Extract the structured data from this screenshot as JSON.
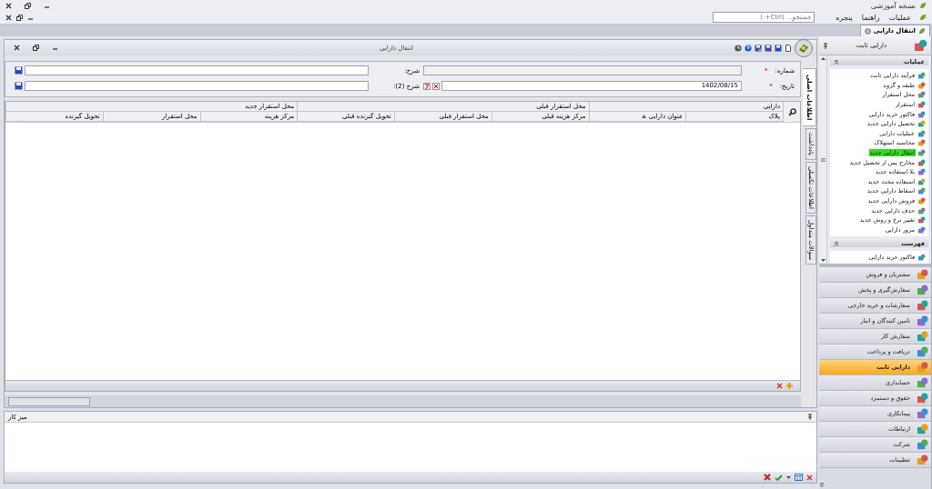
{
  "app": {
    "title": "نسخه آموزشی"
  },
  "menu": [
    {
      "label": "عملیات"
    },
    {
      "label": "راهنما"
    },
    {
      "label": "پنجره"
    }
  ],
  "search": {
    "placeholder": "جستجو... (Ctrl+-)"
  },
  "doc_tabs": [
    {
      "label": "انتقال دارایی",
      "selected": true
    }
  ],
  "window": {
    "title": "انتقال دارایی"
  },
  "side_tabs": [
    {
      "label": "اطلاعات اصلی",
      "selected": true
    },
    {
      "label": "یادداشت",
      "selected": false
    },
    {
      "label": "اطلاعات تکمیلی",
      "selected": false
    },
    {
      "label": "سوالات متداول",
      "selected": false
    }
  ],
  "form": {
    "fields": [
      {
        "label": "شماره:",
        "mark": "*",
        "disabled": true
      },
      {
        "label": "شرح:",
        "disabled": false
      },
      {
        "label": "تاریخ:",
        "mark": "*",
        "value": "1402/08/15",
        "disabled": false
      },
      {
        "label": "شرح (2):",
        "disabled": false
      }
    ]
  },
  "grid": {
    "groups": [
      {
        "label": "دارایی",
        "columns": [
          {
            "label": "پلاک",
            "sorted": false
          },
          {
            "label": "عنوان دارایی",
            "sorted": true
          }
        ]
      },
      {
        "label": "محل استقرار قبلی",
        "columns": [
          {
            "label": "مرکز هزینه قبلی",
            "sorted": false
          },
          {
            "label": "محل استقرار قبلی",
            "sorted": false
          },
          {
            "label": "تحویل گیرنده قبلی",
            "sorted": false
          }
        ]
      },
      {
        "label": "محل استقرار جدید",
        "columns": [
          {
            "label": "مرکز هزینه",
            "sorted": false
          },
          {
            "label": "محل استقرار",
            "sorted": false
          },
          {
            "label": "تحویل گیرنده",
            "sorted": false
          }
        ]
      }
    ]
  },
  "workspace": {
    "title": "میز کار"
  },
  "sidebar": {
    "title": "دارایی ثابت",
    "sections": [
      {
        "title": "عملیات",
        "expanded": true,
        "items": [
          {
            "label": "فرآیند دارایی ثابت",
            "selected": false
          },
          {
            "label": "طبقه و گروه",
            "selected": false
          },
          {
            "label": "محل استقرار",
            "selected": false
          },
          {
            "label": "استقرار",
            "selected": false
          },
          {
            "label": "فاکتور خرید دارایی",
            "selected": false
          },
          {
            "label": "تحصیل دارایی جدید",
            "selected": false
          },
          {
            "label": "عملیات دارایی",
            "selected": false
          },
          {
            "label": "محاسبه استهلاک",
            "selected": false
          },
          {
            "label": "انتقال دارایی جدید",
            "selected": true
          },
          {
            "label": "مخارج پس از تحصیل جدید",
            "selected": false
          },
          {
            "label": "بلا استفاده جدید",
            "selected": false
          },
          {
            "label": "استفاده مجدد جدید",
            "selected": false
          },
          {
            "label": "اسقاط دارایی جدید",
            "selected": false
          },
          {
            "label": "فروش دارایی جدید",
            "selected": false
          },
          {
            "label": "حذف دارایی جدید",
            "selected": false
          },
          {
            "label": "تغییر نرخ و روش جدید",
            "selected": false
          },
          {
            "label": "مرور دارایی",
            "selected": false
          }
        ]
      },
      {
        "title": "فهرست",
        "expanded": true,
        "items": [
          {
            "label": "فاکتور خرید دارایی",
            "selected": false
          }
        ]
      }
    ]
  },
  "modules": [
    {
      "label": "مشتریان و فروش",
      "selected": false
    },
    {
      "label": "سفارش‌گیری و پخش",
      "selected": false
    },
    {
      "label": "سفارشات و خرید خارجی",
      "selected": false
    },
    {
      "label": "تامین کنندگان و انبار",
      "selected": false
    },
    {
      "label": "سفارش کار",
      "selected": false
    },
    {
      "label": "دریافت و پرداخت",
      "selected": false
    },
    {
      "label": "دارایی ثابت",
      "selected": true
    },
    {
      "label": "حسابداری",
      "selected": false
    },
    {
      "label": "حقوق و دستمزد",
      "selected": false
    },
    {
      "label": "پیمانکاری",
      "selected": false
    },
    {
      "label": "ارتباطات",
      "selected": false
    },
    {
      "label": "شرکت",
      "selected": false
    },
    {
      "label": "تنظیمات",
      "selected": false
    }
  ]
}
